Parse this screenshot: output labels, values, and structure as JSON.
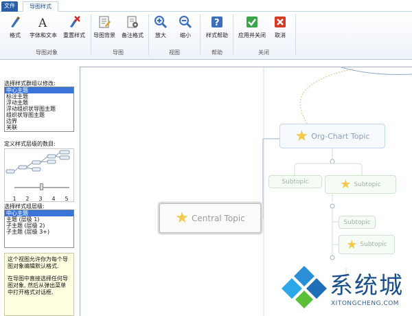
{
  "tabs": {
    "file": "文件",
    "style": "导图样式"
  },
  "ribbon": {
    "buttons": {
      "style": "格式",
      "font": "字体和文本",
      "reset": "重置样式",
      "background": "导图背景",
      "notes": "备注格式",
      "zoom_in": "放大",
      "zoom_out": "缩小",
      "help": "样式帮助",
      "apply_close": "应用并关闭",
      "cancel": "取消"
    },
    "groups": {
      "objects": "导图对象",
      "map": "导图",
      "view": "视图",
      "help": "帮助",
      "close": "关闭"
    }
  },
  "left": {
    "select_label": "选择样式群组以修改:",
    "select_items": [
      "中心主题",
      "标注主题",
      "浮动主题",
      "浮动组织状导图主题",
      "组织状导图主题",
      "边界",
      "关联"
    ],
    "levels_label": "定义样式层级的数目:",
    "ticks": [
      "1",
      "2",
      "3",
      "4",
      "5"
    ],
    "slider_value": 3,
    "level_group_label": "选择样式组层级:",
    "level_items": [
      "中心主题",
      "主题 (层级 1)",
      "子主题 (层级 2)",
      "子主题 (层级 3+)"
    ],
    "help_p1": "这个视图允许你为每个导图对象编辑默认格式.",
    "help_p2": "在导图中直接选择任何导图对象, 然后从弹出菜单中打开格式对话框."
  },
  "canvas": {
    "central": "Central Topic",
    "org": "Org-Chart Topic",
    "sub1": "Subtopic",
    "sub2": "Subtopic",
    "sub3": "Subtopic",
    "sub4": "Subtopic"
  },
  "watermark": {
    "name": "系统城",
    "url": "XITONGCHENG.COM"
  },
  "colors": {
    "accent": "#2a5fa8",
    "selection": "#3a74d8",
    "help_bg": "#ffffe2"
  }
}
